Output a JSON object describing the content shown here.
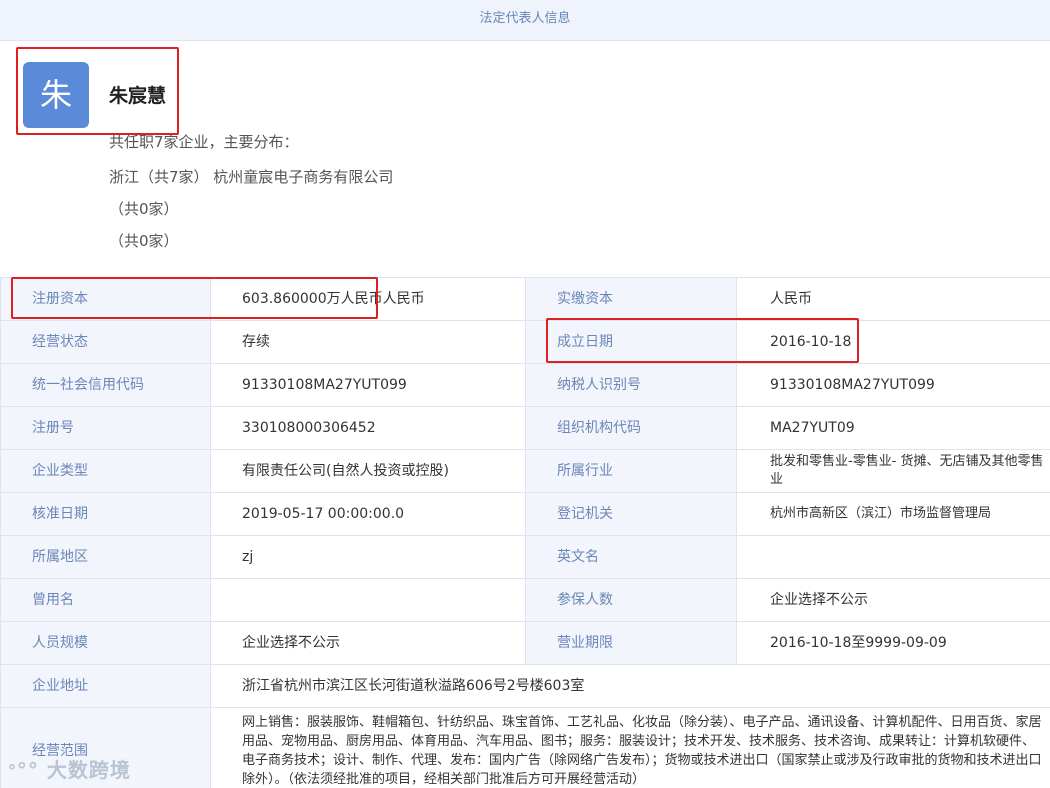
{
  "header": {
    "title": "法定代表人信息"
  },
  "person": {
    "avatar_char": "朱",
    "name": "朱宸慧",
    "summary": "共任职7家企业，主要分布：",
    "distribution": [
      "浙江（共7家） 杭州童宸电子商务有限公司",
      "（共0家）",
      "（共0家）"
    ]
  },
  "rows": [
    {
      "l1": "注册资本",
      "v1": "603.860000万人民币人民币",
      "l2": "实缴资本",
      "v2": "人民币"
    },
    {
      "l1": "经营状态",
      "v1": "存续",
      "l2": "成立日期",
      "v2": "2016-10-18"
    },
    {
      "l1": "统一社会信用代码",
      "v1": "91330108MA27YUT099",
      "l2": "纳税人识别号",
      "v2": "91330108MA27YUT099"
    },
    {
      "l1": "注册号",
      "v1": "330108000306452",
      "l2": "组织机构代码",
      "v2": "MA27YUT09"
    },
    {
      "l1": "企业类型",
      "v1": "有限责任公司(自然人投资或控股)",
      "l2": "所属行业",
      "v2": "批发和零售业-零售业- 货摊、无店铺及其他零售业"
    },
    {
      "l1": "核准日期",
      "v1": "2019-05-17 00:00:00.0",
      "l2": "登记机关",
      "v2": "杭州市高新区（滨江）市场监督管理局"
    },
    {
      "l1": "所属地区",
      "v1": "zj",
      "l2": "英文名",
      "v2": ""
    },
    {
      "l1": "曾用名",
      "v1": "",
      "l2": "参保人数",
      "v2": "企业选择不公示"
    },
    {
      "l1": "人员规模",
      "v1": "企业选择不公示",
      "l2": "营业期限",
      "v2": "2016-10-18至9999-09-09"
    }
  ],
  "address": {
    "label": "企业地址",
    "value": "浙江省杭州市滨江区长河街道秋溢路606号2号楼603室"
  },
  "scope": {
    "label": "经营范围",
    "value": "网上销售：服装服饰、鞋帽箱包、针纺织品、珠宝首饰、工艺礼品、化妆品（除分装）、电子产品、通讯设备、计算机配件、日用百货、家居用品、宠物用品、厨房用品、体育用品、汽车用品、图书；服务：服装设计；技术开发、技术服务、技术咨询、成果转让：计算机软硬件、电子商务技术；设计、制作、代理、发布：国内广告（除网络广告发布）；货物或技术进出口（国家禁止或涉及行政审批的货物和技术进出口除外）。（依法须经批准的项目，经相关部门批准后方可开展经营活动）"
  },
  "watermark": "大数跨境",
  "colors": {
    "label_bg": "#f2f6fc",
    "label_text": "#6b86b8",
    "avatar_bg": "#5b8ad9",
    "highlight": "#e02020"
  }
}
